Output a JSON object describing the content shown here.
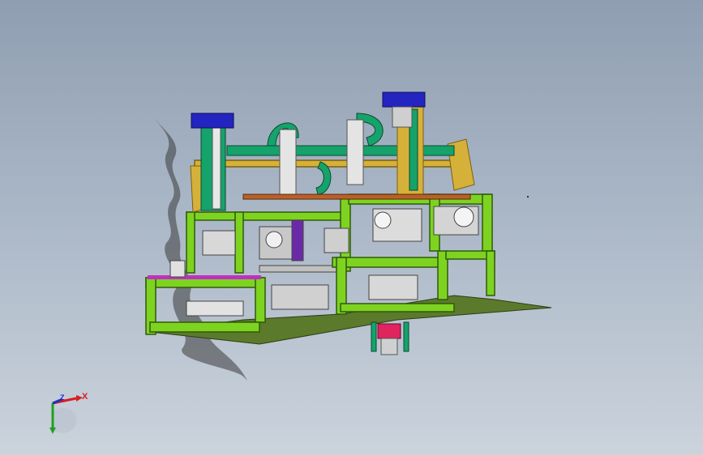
{
  "viewport": {
    "background_top": "#8f9eb1",
    "background_bottom": "#cbd3dc"
  },
  "model": {
    "frame_color": "#7ed321",
    "frame_edge_color": "#2f5a0a",
    "base_plate_color": "#556b2f",
    "top_block_color": "#2424c0",
    "pink_block_color": "#e0245e",
    "teal_part_color": "#15a36b",
    "gold_part_color": "#d6b13a",
    "magenta_strip_color": "#c030c0"
  },
  "triad": {
    "x_label": "X",
    "z_label": "Z",
    "x_color": "#d81e1e",
    "y_color": "#20a020",
    "z_color": "#2030c0"
  }
}
